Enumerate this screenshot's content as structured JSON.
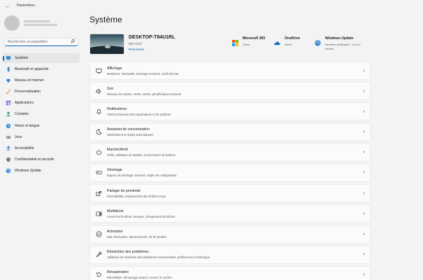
{
  "window": {
    "title": "Paramètres",
    "back_icon": "back-arrow-icon"
  },
  "sidebar": {
    "search": {
      "placeholder": "Rechercher un paramètre",
      "icon": "search-icon"
    },
    "items": [
      {
        "label": "Système",
        "icon": "monitor-icon",
        "active": true
      },
      {
        "label": "Bluetooth et appareils",
        "icon": "bluetooth-icon",
        "active": false
      },
      {
        "label": "Réseau et Internet",
        "icon": "wifi-icon",
        "active": false
      },
      {
        "label": "Personnalisation",
        "icon": "brush-icon",
        "active": false
      },
      {
        "label": "Applications",
        "icon": "apps-icon",
        "active": false
      },
      {
        "label": "Comptes",
        "icon": "account-icon",
        "active": false
      },
      {
        "label": "Heure et langue",
        "icon": "clock-globe-icon",
        "active": false
      },
      {
        "label": "Jeux",
        "icon": "gamepad-icon",
        "active": false
      },
      {
        "label": "Accessibilité",
        "icon": "accessibility-icon",
        "active": false
      },
      {
        "label": "Confidentialité et sécurité",
        "icon": "shield-icon",
        "active": false
      },
      {
        "label": "Windows Update",
        "icon": "update-icon",
        "active": false
      }
    ]
  },
  "main": {
    "title": "Système",
    "device": {
      "name": "DESKTOP-T84U1RL",
      "model": "MS-7C37",
      "rename": "Renommer"
    },
    "quick_tiles": [
      {
        "title": "Microsoft 365",
        "status": "Gérer",
        "icon": "microsoft-logo-icon"
      },
      {
        "title": "OneDrive",
        "status": "Gérer",
        "icon": "onedrive-cloud-icon"
      },
      {
        "title": "Windows Update",
        "status": "Dernière vérification : il y a 9 heures",
        "icon": "windows-update-icon"
      }
    ],
    "cards": [
      {
        "title": "Affichage",
        "subtitle": "Moniteurs, luminosité, éclairage nocturne, profil d'écran",
        "icon": "display-icon"
      },
      {
        "title": "Son",
        "subtitle": "Niveaux de volume, sortie, entrée, périphériques sonores",
        "icon": "speaker-icon"
      },
      {
        "title": "Notifications",
        "subtitle": "Alertes provenant des applications et du système.",
        "icon": "bell-icon"
      },
      {
        "title": "Assistant de concentration",
        "subtitle": "Notifications et règles automatiques",
        "icon": "moon-icon"
      },
      {
        "title": "Marche/Arrêt",
        "subtitle": "Veille, utilisation de batterie, économiseur de batterie",
        "icon": "power-icon"
      },
      {
        "title": "Stockage",
        "subtitle": "Espace de stockage, lecteurs, règles de configuration",
        "icon": "storage-icon"
      },
      {
        "title": "Partage de proximité",
        "subtitle": "Détectabilité, emplacement des fichiers reçus",
        "icon": "share-icon"
      },
      {
        "title": "Multitâche",
        "subtitle": "Ancrer les fenêtres, bureaux, changement de tâches",
        "icon": "multitask-icon"
      },
      {
        "title": "Activation",
        "subtitle": "État d'activation, abonnements, clé de produit",
        "icon": "check-circle-icon"
      },
      {
        "title": "Résolution des problèmes",
        "subtitle": "Utilitaires de résolution des problèmes recommandés, préférences et historique",
        "icon": "wrench-icon"
      },
      {
        "title": "Récupération",
        "subtitle": "Réinitialiser, démarrage avancé, revenir en arrière",
        "icon": "recovery-icon"
      }
    ]
  }
}
